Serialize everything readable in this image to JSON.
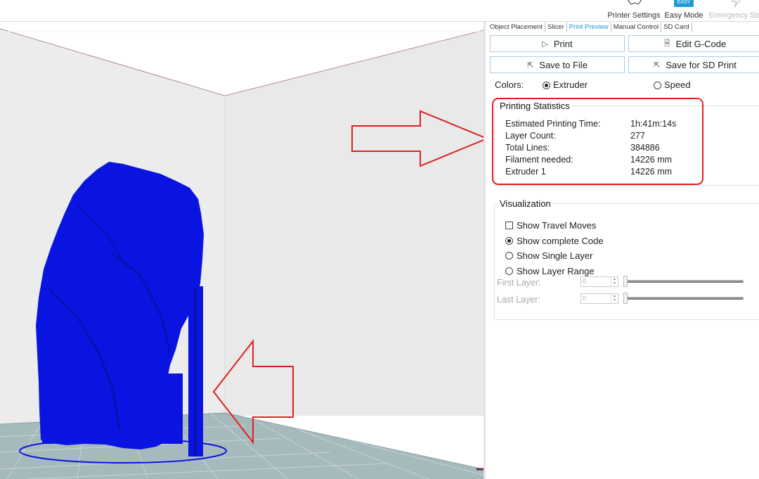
{
  "toolbar": {
    "printer_settings": "Printer Settings",
    "easy_mode": "Easy Mode",
    "easy_badge": "EASY",
    "emergency_stop": "Emergency Stop"
  },
  "tabs": [
    "Object Placement",
    "Slicer",
    "Print Preview",
    "Manual Control",
    "SD Card"
  ],
  "active_tab": "Print Preview",
  "actions": {
    "print": "Print",
    "edit_gcode": "Edit G-Code",
    "save_to_file": "Save to File",
    "save_for_sd": "Save for SD Print"
  },
  "colors": {
    "label": "Colors:",
    "extruder": "Extruder",
    "speed": "Speed",
    "selected": "Extruder"
  },
  "stats": {
    "title": "Printing Statistics",
    "rows": [
      {
        "label": "Estimated Printing Time:",
        "value": "1h:41m:14s"
      },
      {
        "label": "Layer Count:",
        "value": "277"
      },
      {
        "label": "Total Lines:",
        "value": "384886"
      },
      {
        "label": "Filament needed:",
        "value": "14226 mm"
      },
      {
        "label": "Extruder 1",
        "value": "14226 mm"
      }
    ]
  },
  "visualization": {
    "title": "Visualization",
    "show_travel_moves": "Show Travel Moves",
    "show_complete_code": "Show complete Code",
    "show_single_layer": "Show Single Layer",
    "show_layer_range": "Show Layer Range",
    "selected": "Show complete Code",
    "first_layer_label": "First Layer:",
    "first_layer_value": "0",
    "last_layer_label": "Last Layer:",
    "last_layer_value": "0"
  },
  "style": {
    "model_color": "#0a14e0",
    "bed_color": "#a6b9bc",
    "accent": "#1e9bd7",
    "annotation_red": "#e02020"
  }
}
